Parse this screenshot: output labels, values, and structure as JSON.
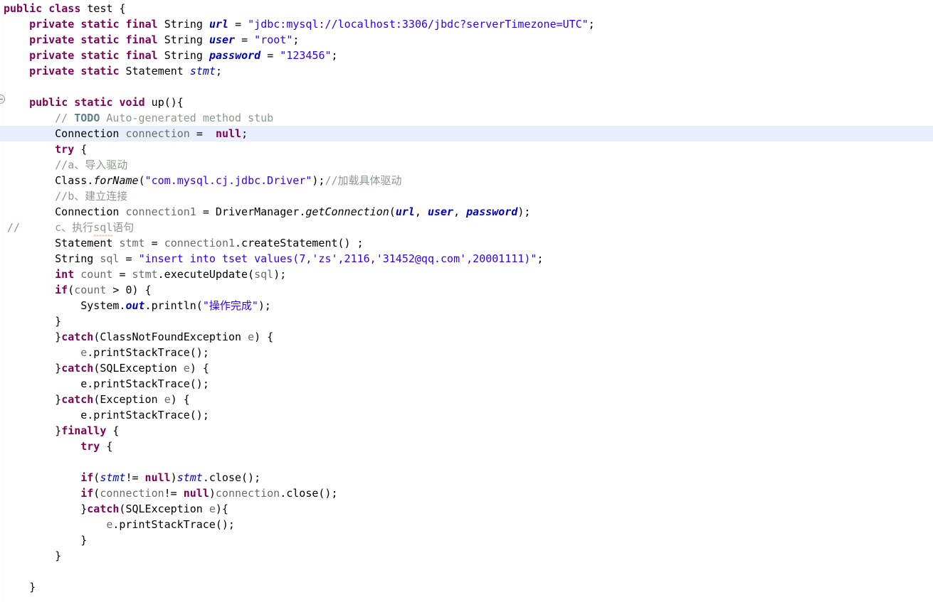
{
  "editor": {
    "language": "Java",
    "class_name": "test",
    "current_line_index": 8,
    "colors": {
      "background": "#ffffff",
      "keyword": "#7f0055",
      "string": "#2a00ff",
      "field": "#0000c0",
      "comment": "#8a9a8a",
      "local_variable": "#6a6a6a",
      "current_line_highlight": "#e8eefb",
      "text": "#000000",
      "squiggle": "#d08a50"
    },
    "gutter": {
      "fold_marker_icon": "collapse-fold-icon",
      "fold_marker_line": 6,
      "comment_marker": "//"
    }
  },
  "code": {
    "lines": [
      {
        "n": 1,
        "indent": 0,
        "text": "public class test {"
      },
      {
        "n": 2,
        "indent": 4,
        "text": "private static final String url = \"jdbc:mysql://localhost:3306/jbdc?serverTimezone=UTC\";"
      },
      {
        "n": 3,
        "indent": 4,
        "text": "private static final String user = \"root\";"
      },
      {
        "n": 4,
        "indent": 4,
        "text": "private static final String password = \"123456\";"
      },
      {
        "n": 5,
        "indent": 4,
        "text": "private static Statement stmt;"
      },
      {
        "n": 6,
        "indent": 0,
        "text": ""
      },
      {
        "n": 7,
        "indent": 4,
        "text": "public static void up(){"
      },
      {
        "n": 8,
        "indent": 8,
        "text": "// TODO Auto-generated method stub"
      },
      {
        "n": 9,
        "indent": 8,
        "text": "Connection connection =  null;"
      },
      {
        "n": 10,
        "indent": 8,
        "text": "try {"
      },
      {
        "n": 11,
        "indent": 8,
        "text": "//a、导入驱动"
      },
      {
        "n": 12,
        "indent": 8,
        "text": "Class.forName(\"com.mysql.cj.jdbc.Driver\");//加载具体驱动"
      },
      {
        "n": 13,
        "indent": 8,
        "text": "//b、建立连接"
      },
      {
        "n": 14,
        "indent": 8,
        "text": "Connection connection1 = DriverManager.getConnection(url, user, password);"
      },
      {
        "n": 15,
        "indent": 8,
        "text": "c、执行sql语句",
        "gutter_comment": "//"
      },
      {
        "n": 16,
        "indent": 8,
        "text": "Statement stmt = connection1.createStatement() ;"
      },
      {
        "n": 17,
        "indent": 8,
        "text": "String sql = \"insert into tset values(7,'zs',2116,'31452@qq.com',20001111)\";"
      },
      {
        "n": 18,
        "indent": 8,
        "text": "int count = stmt.executeUpdate(sql);"
      },
      {
        "n": 19,
        "indent": 8,
        "text": "if(count > 0) {"
      },
      {
        "n": 20,
        "indent": 12,
        "text": "System.out.println(\"操作完成\");"
      },
      {
        "n": 21,
        "indent": 8,
        "text": "}"
      },
      {
        "n": 22,
        "indent": 8,
        "text": "}catch(ClassNotFoundException e) {"
      },
      {
        "n": 23,
        "indent": 12,
        "text": "e.printStackTrace();"
      },
      {
        "n": 24,
        "indent": 8,
        "text": "}catch(SQLException e) {"
      },
      {
        "n": 25,
        "indent": 12,
        "text": "e.printStackTrace();"
      },
      {
        "n": 26,
        "indent": 8,
        "text": "}catch(Exception e) {"
      },
      {
        "n": 27,
        "indent": 12,
        "text": "e.printStackTrace();"
      },
      {
        "n": 28,
        "indent": 8,
        "text": "}finally {"
      },
      {
        "n": 29,
        "indent": 12,
        "text": "try {"
      },
      {
        "n": 30,
        "indent": 0,
        "text": ""
      },
      {
        "n": 31,
        "indent": 12,
        "text": "if(stmt!= null)stmt.close();"
      },
      {
        "n": 32,
        "indent": 12,
        "text": "if(connection!= null)connection.close();"
      },
      {
        "n": 33,
        "indent": 12,
        "text": "}catch(SQLException e){"
      },
      {
        "n": 34,
        "indent": 16,
        "text": "e.printStackTrace();"
      },
      {
        "n": 35,
        "indent": 12,
        "text": "}"
      },
      {
        "n": 36,
        "indent": 8,
        "text": "}"
      },
      {
        "n": 37,
        "indent": 0,
        "text": ""
      },
      {
        "n": 38,
        "indent": 4,
        "text": "}"
      }
    ],
    "strings": {
      "url_value": "jdbc:mysql://localhost:3306/jbdc?serverTimezone=UTC",
      "user_value": "root",
      "password_value": "123456",
      "driver_class": "com.mysql.cj.jdbc.Driver",
      "sql_statement": "insert into tset values(7,'zs',2116,'31452@qq.com',20001111)",
      "println_message": "操作完成"
    },
    "comments": {
      "todo": "// TODO Auto-generated method stub",
      "step_a": "//a、导入驱动",
      "load_driver": "//加载具体驱动",
      "step_b": "//b、建立连接",
      "step_c": "c、执行sql语句"
    },
    "tokens": {
      "l1": [
        [
          "kw",
          "public"
        ],
        [
          "pln",
          " "
        ],
        [
          "kw",
          "class"
        ],
        [
          "pln",
          " test {"
        ]
      ],
      "l2": [
        [
          "kw",
          "private"
        ],
        [
          "pln",
          " "
        ],
        [
          "kw",
          "static"
        ],
        [
          "pln",
          " "
        ],
        [
          "kw",
          "final"
        ],
        [
          "pln",
          " String "
        ],
        [
          "fld",
          "url"
        ],
        [
          "pln",
          " = "
        ],
        [
          "str",
          "\"jdbc:mysql://localhost:3306/jbdc?serverTimezone=UTC\""
        ],
        [
          "pln",
          ";"
        ]
      ],
      "l3": [
        [
          "kw",
          "private"
        ],
        [
          "pln",
          " "
        ],
        [
          "kw",
          "static"
        ],
        [
          "pln",
          " "
        ],
        [
          "kw",
          "final"
        ],
        [
          "pln",
          " String "
        ],
        [
          "fld",
          "user"
        ],
        [
          "pln",
          " = "
        ],
        [
          "str",
          "\"root\""
        ],
        [
          "pln",
          ";"
        ]
      ],
      "l4": [
        [
          "kw",
          "private"
        ],
        [
          "pln",
          " "
        ],
        [
          "kw",
          "static"
        ],
        [
          "pln",
          " "
        ],
        [
          "kw",
          "final"
        ],
        [
          "pln",
          " String "
        ],
        [
          "fld",
          "password"
        ],
        [
          "pln",
          " = "
        ],
        [
          "str",
          "\"123456\""
        ],
        [
          "pln",
          ";"
        ]
      ],
      "l5": [
        [
          "kw",
          "private"
        ],
        [
          "pln",
          " "
        ],
        [
          "kw",
          "static"
        ],
        [
          "pln",
          " Statement "
        ],
        [
          "fldn",
          "stmt"
        ],
        [
          "pln",
          ";"
        ]
      ],
      "l7": [
        [
          "kw",
          "public"
        ],
        [
          "pln",
          " "
        ],
        [
          "kw",
          "static"
        ],
        [
          "pln",
          " "
        ],
        [
          "kw",
          "void"
        ],
        [
          "pln",
          " up(){"
        ]
      ],
      "l8": [
        [
          "cmt",
          "// "
        ],
        [
          "todo",
          "TODO"
        ],
        [
          "cmt",
          " Auto-generated method stub"
        ]
      ],
      "l9": [
        [
          "pln",
          "Connection "
        ],
        [
          "loc",
          "connection"
        ],
        [
          "pln",
          " =  "
        ],
        [
          "kw",
          "null"
        ],
        [
          "pln",
          ";"
        ]
      ],
      "l10": [
        [
          "kw",
          "try"
        ],
        [
          "pln",
          " {"
        ]
      ],
      "l11": [
        [
          "cmt",
          "//a、导入驱动"
        ]
      ],
      "l12": [
        [
          "pln",
          "Class."
        ],
        [
          "mtd",
          "forName"
        ],
        [
          "pln",
          "("
        ],
        [
          "str",
          "\"com.mysql.cj.jdbc.Driver\""
        ],
        [
          "pln",
          ");"
        ],
        [
          "cmt",
          "//加载具体驱动"
        ]
      ],
      "l13": [
        [
          "cmt",
          "//b、建立连接"
        ]
      ],
      "l14": [
        [
          "pln",
          "Connection "
        ],
        [
          "loc",
          "connection1"
        ],
        [
          "pln",
          " = DriverManager."
        ],
        [
          "mtd",
          "getConnection"
        ],
        [
          "pln",
          "("
        ],
        [
          "fld",
          "url"
        ],
        [
          "pln",
          ", "
        ],
        [
          "fld",
          "user"
        ],
        [
          "pln",
          ", "
        ],
        [
          "fld",
          "password"
        ],
        [
          "pln",
          ");"
        ]
      ],
      "l15": [
        [
          "cmt",
          "c、执行sql语句"
        ]
      ],
      "l16": [
        [
          "pln",
          "Statement "
        ],
        [
          "loc",
          "stmt"
        ],
        [
          "pln",
          " = "
        ],
        [
          "loc",
          "connection1"
        ],
        [
          "pln",
          ".createStatement() ;"
        ]
      ],
      "l17": [
        [
          "pln",
          "String "
        ],
        [
          "loc",
          "sql"
        ],
        [
          "pln",
          " = "
        ],
        [
          "str",
          "\"insert into tset values(7,'zs',2116,'31452@qq.com',20001111)\""
        ],
        [
          "pln",
          ";"
        ]
      ],
      "l18": [
        [
          "kw",
          "int"
        ],
        [
          "pln",
          " "
        ],
        [
          "loc",
          "count"
        ],
        [
          "pln",
          " = "
        ],
        [
          "loc",
          "stmt"
        ],
        [
          "pln",
          ".executeUpdate("
        ],
        [
          "loc",
          "sql"
        ],
        [
          "pln",
          ");"
        ]
      ],
      "l19": [
        [
          "kw",
          "if"
        ],
        [
          "pln",
          "("
        ],
        [
          "loc",
          "count"
        ],
        [
          "pln",
          " > 0) {"
        ]
      ],
      "l20": [
        [
          "pln",
          "System."
        ],
        [
          "fld",
          "out"
        ],
        [
          "pln",
          ".println("
        ],
        [
          "str",
          "\"操作完成\""
        ],
        [
          "pln",
          ");"
        ]
      ],
      "l21": [
        [
          "pln",
          "}"
        ]
      ],
      "l22": [
        [
          "pln",
          "}"
        ],
        [
          "kw",
          "catch"
        ],
        [
          "pln",
          "(ClassNotFoundException "
        ],
        [
          "loc",
          "e"
        ],
        [
          "pln",
          ") {"
        ]
      ],
      "l23": [
        [
          "loc",
          "e"
        ],
        [
          "pln",
          ".printStackTrace();"
        ]
      ],
      "l24": [
        [
          "pln",
          "}"
        ],
        [
          "kw",
          "catch"
        ],
        [
          "pln",
          "(SQLException "
        ],
        [
          "loc",
          "e"
        ],
        [
          "pln",
          ") {"
        ]
      ],
      "l26": [
        [
          "pln",
          "}"
        ],
        [
          "kw",
          "catch"
        ],
        [
          "pln",
          "(Exception "
        ],
        [
          "loc",
          "e"
        ],
        [
          "pln",
          ") {"
        ]
      ],
      "l28": [
        [
          "pln",
          "}"
        ],
        [
          "kw",
          "finally"
        ],
        [
          "pln",
          " {"
        ]
      ],
      "l29": [
        [
          "kw",
          "try"
        ],
        [
          "pln",
          " {"
        ]
      ],
      "l31": [
        [
          "kw",
          "if"
        ],
        [
          "pln",
          "("
        ],
        [
          "fldn",
          "stmt"
        ],
        [
          "pln",
          "!= "
        ],
        [
          "kw",
          "null"
        ],
        [
          "pln",
          ")"
        ],
        [
          "fldn",
          "stmt"
        ],
        [
          "pln",
          ".close();"
        ]
      ],
      "l32": [
        [
          "kw",
          "if"
        ],
        [
          "pln",
          "("
        ],
        [
          "loc",
          "connection"
        ],
        [
          "pln",
          "!= "
        ],
        [
          "kw",
          "null"
        ],
        [
          "pln",
          ")"
        ],
        [
          "loc",
          "connection"
        ],
        [
          "pln",
          ".close();"
        ]
      ],
      "l33": [
        [
          "pln",
          "}"
        ],
        [
          "kw",
          "catch"
        ],
        [
          "pln",
          "(SQLException "
        ],
        [
          "loc",
          "e"
        ],
        [
          "pln",
          "){"
        ]
      ],
      "l34": [
        [
          "loc",
          "e"
        ],
        [
          "pln",
          ".printStackTrace();"
        ]
      ],
      "l35": [
        [
          "pln",
          "}"
        ]
      ],
      "l36": [
        [
          "pln",
          "}"
        ]
      ],
      "l38": [
        [
          "pln",
          "}"
        ]
      ]
    }
  }
}
